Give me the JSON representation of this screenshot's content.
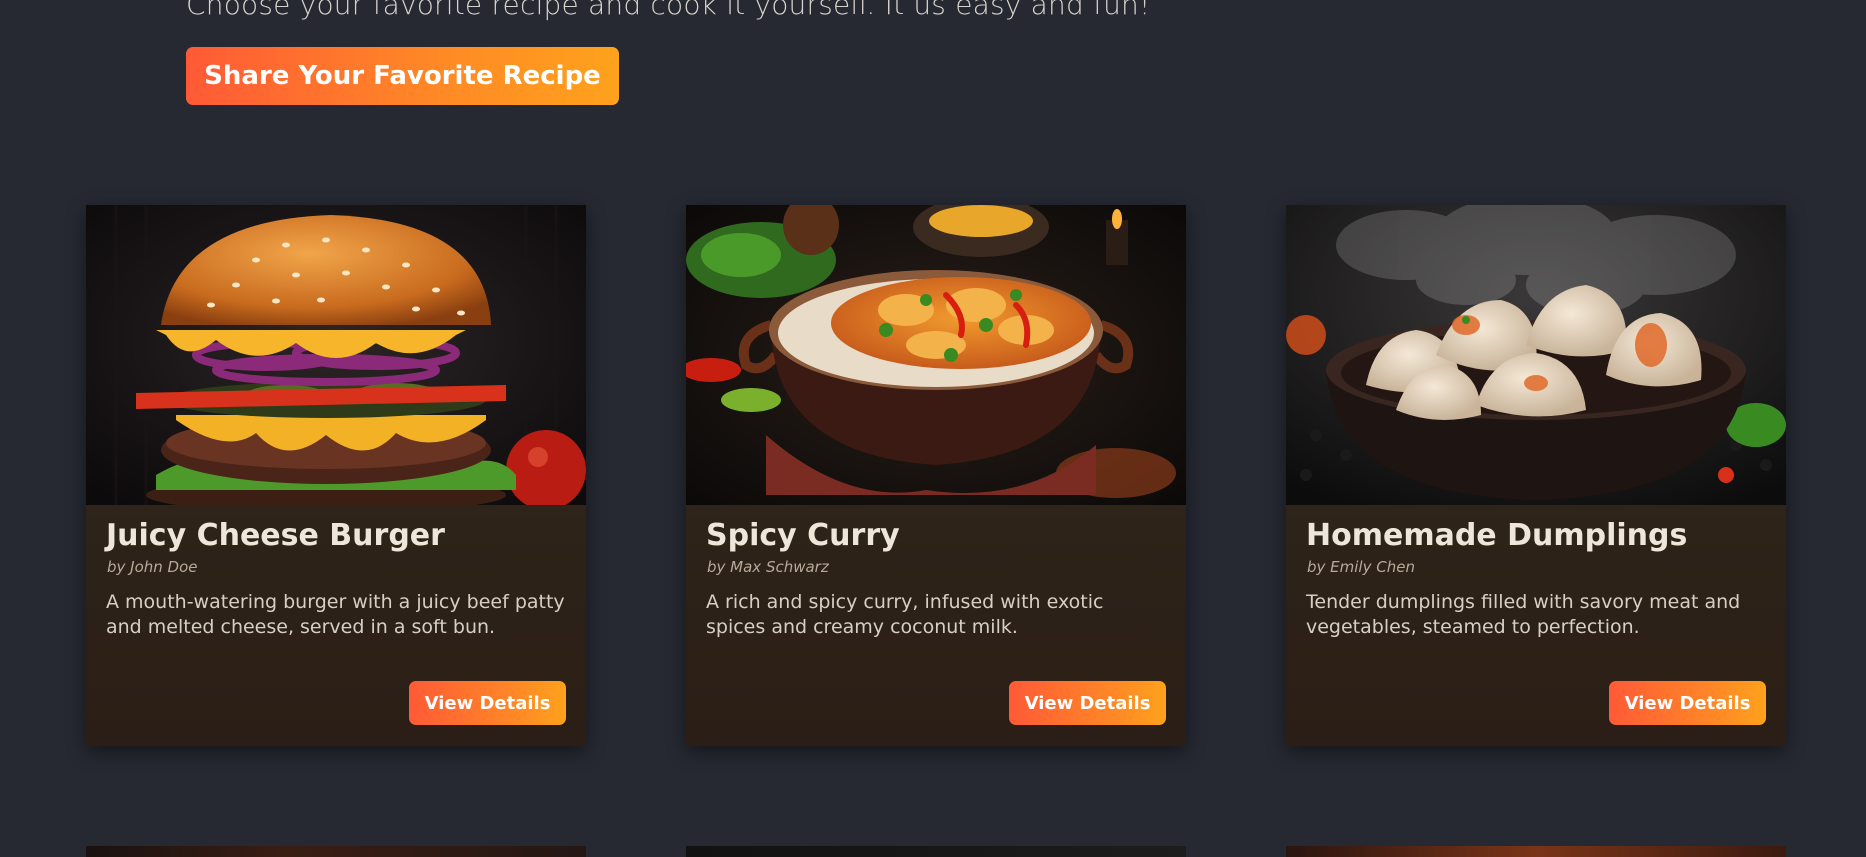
{
  "hero": {
    "subtitle": "Choose your favorite recipe and cook it yourself. It us easy and fun!",
    "cta_label": "Share Your Favorite Recipe"
  },
  "colors": {
    "background": "#262932",
    "accent_start": "#ff5a36",
    "accent_end": "#ffa21c"
  },
  "recipes": [
    {
      "title": "Juicy Cheese Burger",
      "author": "by John Doe",
      "description": "A mouth-watering burger with a juicy beef patty and melted cheese, served in a soft bun.",
      "button_label": "View Details"
    },
    {
      "title": "Spicy Curry",
      "author": "by Max Schwarz",
      "description": "A rich and spicy curry, infused with exotic spices and creamy coconut milk.",
      "button_label": "View Details"
    },
    {
      "title": "Homemade Dumplings",
      "author": "by Emily Chen",
      "description": "Tender dumplings filled with savory meat and vegetables, steamed to perfection.",
      "button_label": "View Details"
    }
  ]
}
